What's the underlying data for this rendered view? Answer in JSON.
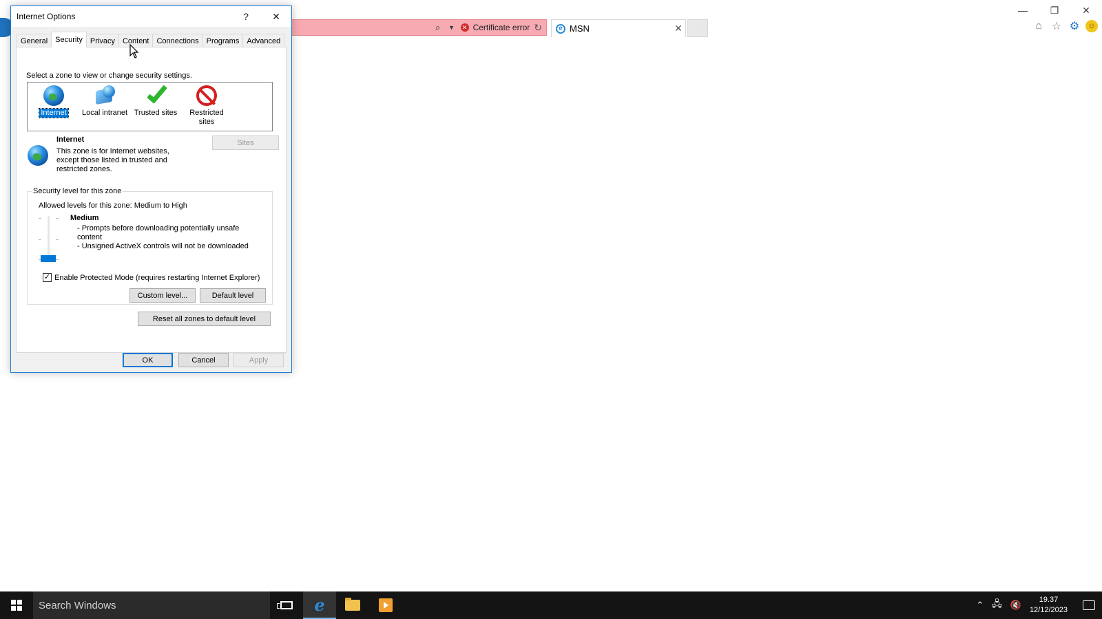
{
  "browser": {
    "certificate_error": "Certificate error",
    "tab_label": "MSN"
  },
  "dialog": {
    "title": "Internet Options",
    "help": "?",
    "close": "✕",
    "tabs": [
      "General",
      "Security",
      "Privacy",
      "Content",
      "Connections",
      "Programs",
      "Advanced"
    ],
    "active_tab": "Security",
    "zone_intro": "Select a zone to view or change security settings.",
    "zones": [
      {
        "label": "Internet",
        "icon": "globe-icon",
        "selected": true
      },
      {
        "label": "Local intranet",
        "icon": "intranet-icon",
        "selected": false
      },
      {
        "label": "Trusted sites",
        "icon": "checkmark-icon",
        "selected": false
      },
      {
        "label": "Restricted\nsites",
        "icon": "restricted-icon",
        "selected": false
      }
    ],
    "zone_name": "Internet",
    "zone_description": "This zone is for Internet websites, except those listed in trusted and restricted zones.",
    "sites_button": "Sites",
    "security_group_label": "Security level for this zone",
    "allowed_levels": "Allowed levels for this zone: Medium to High",
    "level_name": "Medium",
    "level_points": [
      "- Prompts before downloading potentially unsafe content",
      "- Unsigned ActiveX controls will not be downloaded"
    ],
    "protected_mode_label": "Enable Protected Mode (requires restarting Internet Explorer)",
    "protected_mode_checked": true,
    "custom_level_button": "Custom level...",
    "default_level_button": "Default level",
    "reset_button": "Reset all zones to default level",
    "ok_button": "OK",
    "cancel_button": "Cancel",
    "apply_button": "Apply"
  },
  "taskbar": {
    "search_placeholder": "Search Windows",
    "time": "19.37",
    "date": "12/12/2023"
  },
  "colors": {
    "accent": "#0078d7",
    "cert_error_bar": "#f7aab1",
    "taskbar": "#141414"
  }
}
